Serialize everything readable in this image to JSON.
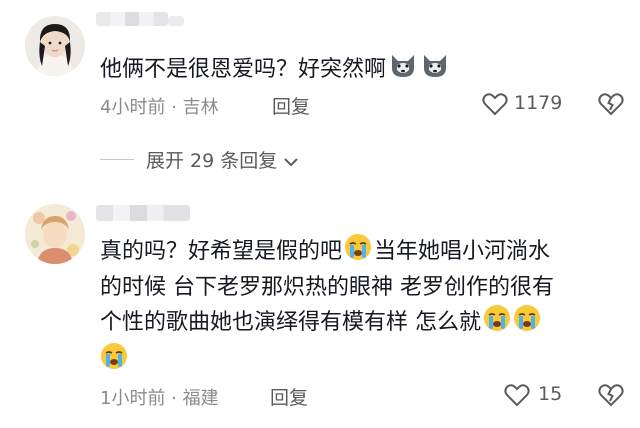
{
  "comments": [
    {
      "text": "他俩不是很恩爱吗？好突然啊",
      "emojis": [
        "husky-emoji",
        "husky-emoji"
      ],
      "time": "4小时前 · 吉林",
      "reply": "回复",
      "likes": "1179",
      "expand": "展开 29 条回复"
    },
    {
      "lines": [
        "真的吗？好希望是假的吧",
        "当年她唱小河淌水",
        "的时候 台下老罗那炽热的眼神 老罗创作的很有",
        "个性的歌曲她也演绎得有模有样 怎么就"
      ],
      "emojis": [
        "crying-emoji",
        "crying-emoji",
        "crying-emoji",
        "crying-emoji"
      ],
      "time": "1小时前 · 福建",
      "reply": "回复",
      "likes": "15"
    }
  ],
  "colors": {
    "text": "#161823",
    "meta": "#8a8b91",
    "secondary": "#5a5b62"
  }
}
